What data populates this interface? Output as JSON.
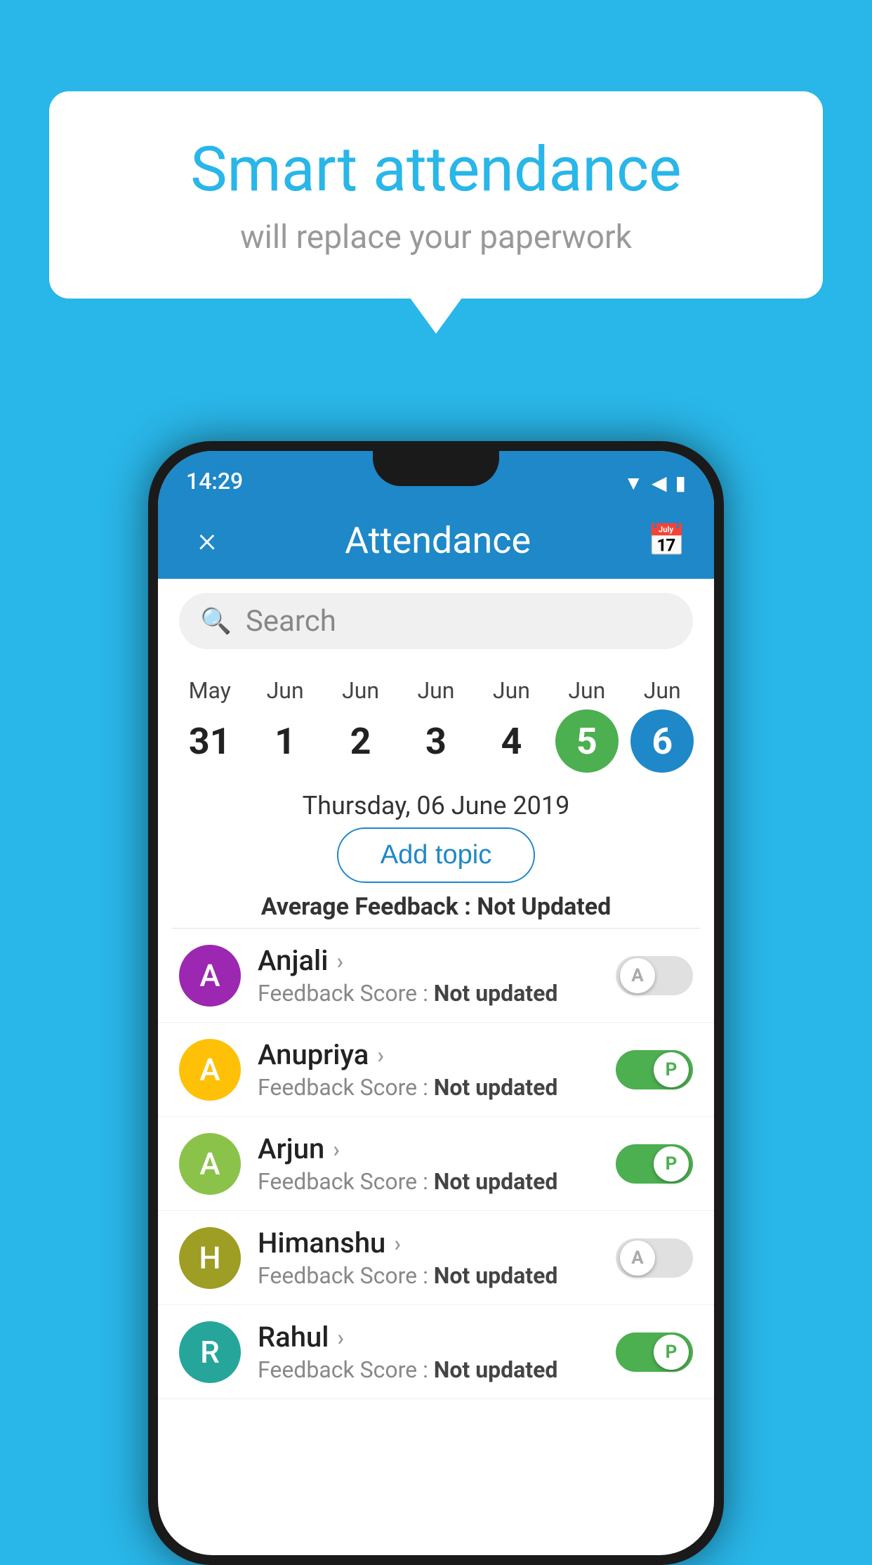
{
  "background_color": "#29B6E8",
  "speech_bubble": {
    "title": "Smart attendance",
    "subtitle": "will replace your paperwork"
  },
  "status_bar": {
    "time": "14:29",
    "icons": [
      "wifi",
      "signal",
      "battery"
    ]
  },
  "header": {
    "title": "Attendance",
    "close_label": "×",
    "calendar_icon": "📅"
  },
  "search": {
    "placeholder": "Search"
  },
  "dates": [
    {
      "month": "May",
      "day": "31",
      "style": "normal"
    },
    {
      "month": "Jun",
      "day": "1",
      "style": "normal"
    },
    {
      "month": "Jun",
      "day": "2",
      "style": "normal"
    },
    {
      "month": "Jun",
      "day": "3",
      "style": "normal"
    },
    {
      "month": "Jun",
      "day": "4",
      "style": "normal"
    },
    {
      "month": "Jun",
      "day": "5",
      "style": "green"
    },
    {
      "month": "Jun",
      "day": "6",
      "style": "blue"
    }
  ],
  "selected_date": "Thursday, 06 June 2019",
  "add_topic_label": "Add topic",
  "avg_feedback": {
    "label": "Average Feedback : ",
    "value": "Not Updated"
  },
  "students": [
    {
      "name": "Anjali",
      "avatar_letter": "A",
      "avatar_color": "purple",
      "feedback": "Not updated",
      "toggle": "off",
      "toggle_letter": "A"
    },
    {
      "name": "Anupriya",
      "avatar_letter": "A",
      "avatar_color": "yellow",
      "feedback": "Not updated",
      "toggle": "on",
      "toggle_letter": "P"
    },
    {
      "name": "Arjun",
      "avatar_letter": "A",
      "avatar_color": "light-green",
      "feedback": "Not updated",
      "toggle": "on",
      "toggle_letter": "P"
    },
    {
      "name": "Himanshu",
      "avatar_letter": "H",
      "avatar_color": "olive",
      "feedback": "Not updated",
      "toggle": "off",
      "toggle_letter": "A"
    },
    {
      "name": "Rahul",
      "avatar_letter": "R",
      "avatar_color": "teal",
      "feedback": "Not updated",
      "toggle": "on",
      "toggle_letter": "P"
    }
  ]
}
